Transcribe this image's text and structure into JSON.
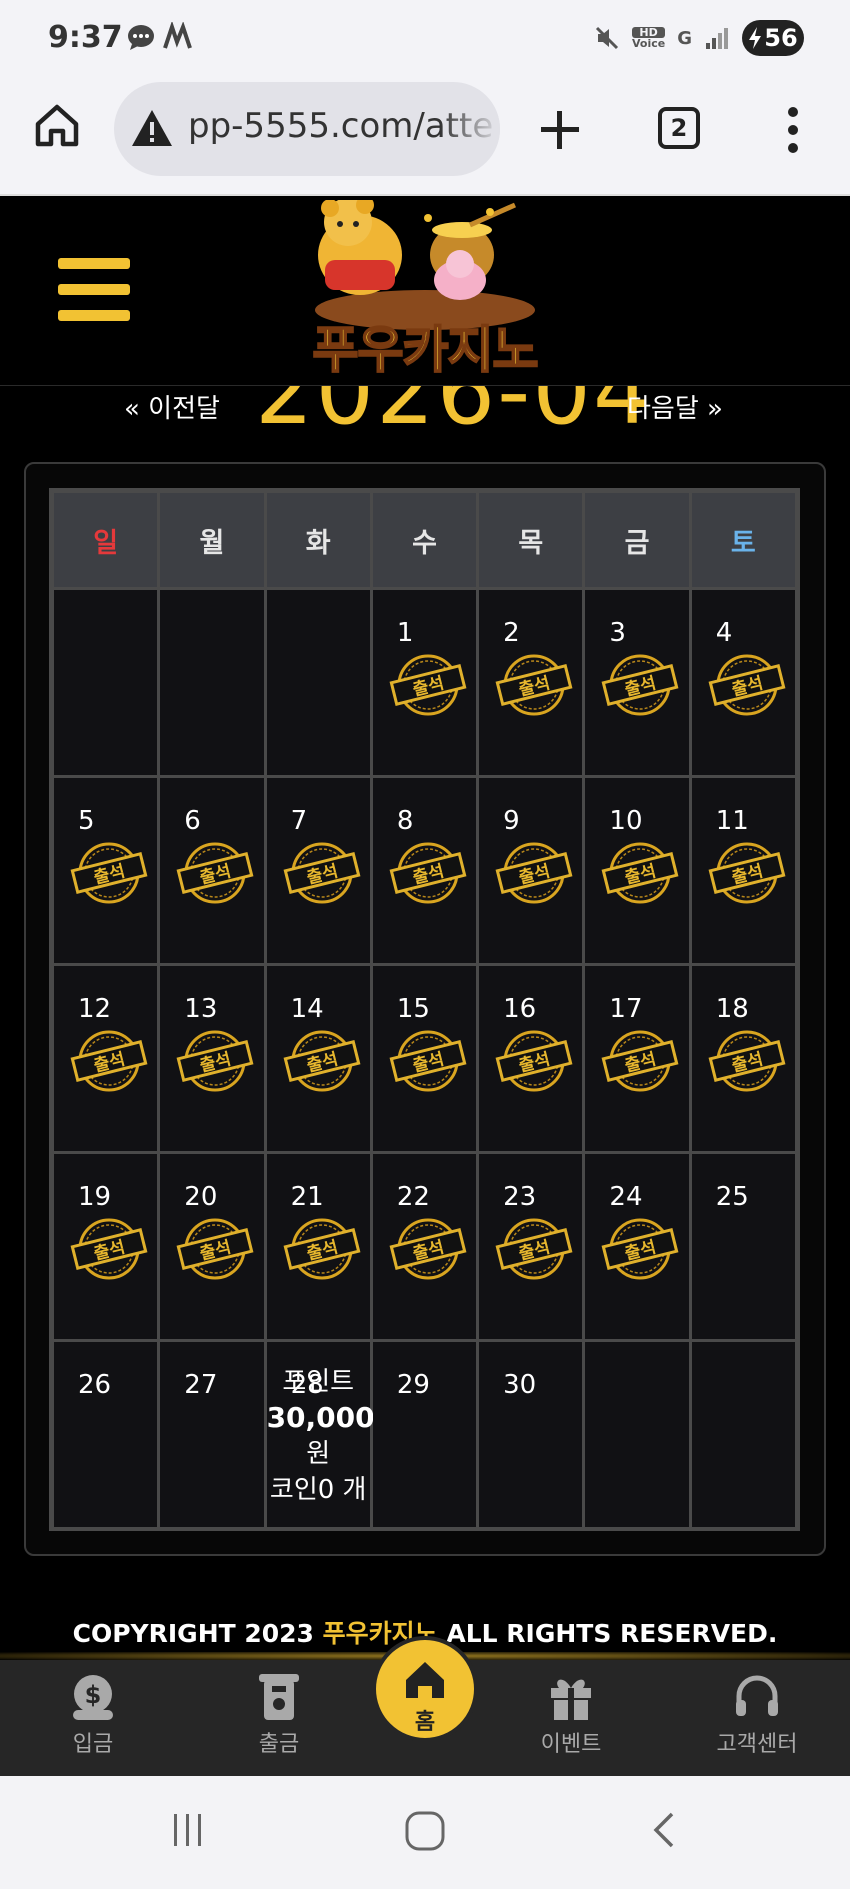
{
  "status_bar": {
    "time": "9:37",
    "battery": "56",
    "network": "G",
    "hd_voice": "HD Voice"
  },
  "browser": {
    "url": "pp-5555.com/atte",
    "tab_count": "2"
  },
  "site": {
    "logo_text": "푸우카지노"
  },
  "calendar": {
    "prev_label": "« 이전달",
    "next_label": "다음달 »",
    "month_title": "2026-04",
    "weekdays": [
      "일",
      "월",
      "화",
      "수",
      "목",
      "금",
      "토"
    ],
    "stamp_label": "출석",
    "weeks": [
      [
        {
          "day": "",
          "stamp": false
        },
        {
          "day": "",
          "stamp": false
        },
        {
          "day": "",
          "stamp": false
        },
        {
          "day": "1",
          "stamp": true
        },
        {
          "day": "2",
          "stamp": true
        },
        {
          "day": "3",
          "stamp": true
        },
        {
          "day": "4",
          "stamp": true
        }
      ],
      [
        {
          "day": "5",
          "stamp": true
        },
        {
          "day": "6",
          "stamp": true
        },
        {
          "day": "7",
          "stamp": true
        },
        {
          "day": "8",
          "stamp": true
        },
        {
          "day": "9",
          "stamp": true
        },
        {
          "day": "10",
          "stamp": true
        },
        {
          "day": "11",
          "stamp": true
        }
      ],
      [
        {
          "day": "12",
          "stamp": true
        },
        {
          "day": "13",
          "stamp": true
        },
        {
          "day": "14",
          "stamp": true
        },
        {
          "day": "15",
          "stamp": true
        },
        {
          "day": "16",
          "stamp": true
        },
        {
          "day": "17",
          "stamp": true
        },
        {
          "day": "18",
          "stamp": true
        }
      ],
      [
        {
          "day": "19",
          "stamp": true
        },
        {
          "day": "20",
          "stamp": true
        },
        {
          "day": "21",
          "stamp": true
        },
        {
          "day": "22",
          "stamp": true
        },
        {
          "day": "23",
          "stamp": true
        },
        {
          "day": "24",
          "stamp": true
        },
        {
          "day": "25",
          "stamp": false
        }
      ],
      [
        {
          "day": "26",
          "stamp": false
        },
        {
          "day": "27",
          "stamp": false
        },
        {
          "day": "28",
          "stamp": false,
          "info": true
        },
        {
          "day": "29",
          "stamp": false
        },
        {
          "day": "30",
          "stamp": false
        },
        {
          "day": "",
          "stamp": false
        },
        {
          "day": "",
          "stamp": false
        }
      ]
    ],
    "reward_info": {
      "point_label": "포인트",
      "point_value": "30,000",
      "point_unit": "원",
      "coin_text": "코인0 개"
    }
  },
  "footer": {
    "copyright_prefix": "COPYRIGHT 2023 ",
    "brand": "푸우카지노",
    "copyright_suffix": " ALL RIGHTS RESERVED."
  },
  "bottom_nav": {
    "deposit": "입금",
    "withdraw": "출금",
    "home": "홈",
    "event": "이벤트",
    "support": "고객센터"
  },
  "colors": {
    "accent": "#f2c233",
    "sunday": "#e5393b",
    "saturday": "#6ab3ea"
  }
}
